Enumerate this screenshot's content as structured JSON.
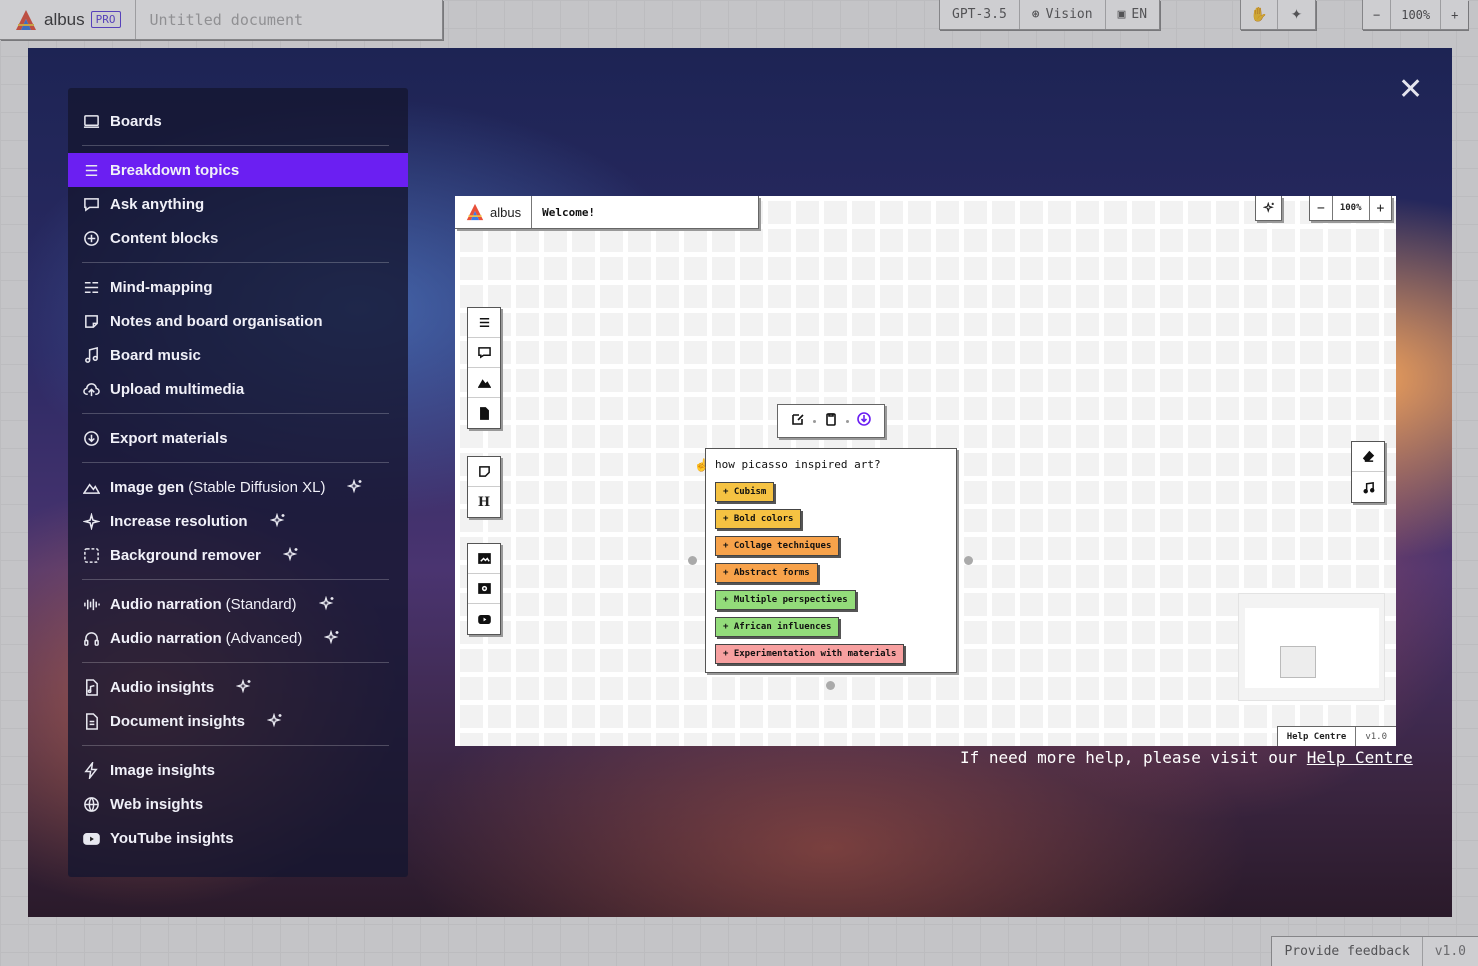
{
  "background_app": {
    "brand": "albus",
    "pro_badge": "PRO",
    "document_title": "Untitled document",
    "models": [
      "GPT-3.5",
      "Vision",
      "EN"
    ],
    "zoom": {
      "minus": "−",
      "value": "100%",
      "plus": "+"
    },
    "feedback": "Provide feedback",
    "version": "v1.0"
  },
  "modal": {
    "close": "✕"
  },
  "menu": {
    "boards": "Boards",
    "breakdown": "Breakdown topics",
    "ask": "Ask anything",
    "content_blocks": "Content blocks",
    "mind_mapping": "Mind-mapping",
    "notes": "Notes and board organisation",
    "music": "Board music",
    "upload": "Upload multimedia",
    "export": "Export materials",
    "image_gen": "Image gen",
    "image_gen_suffix": "(Stable Diffusion XL)",
    "increase_res": "Increase resolution",
    "bg_remover": "Background remover",
    "narration_std": "Audio narration",
    "narration_std_suffix": "(Standard)",
    "narration_adv": "Audio narration",
    "narration_adv_suffix": "(Advanced)",
    "audio_insights": "Audio insights",
    "doc_insights": "Document insights",
    "image_insights": "Image insights",
    "web_insights": "Web insights",
    "youtube_insights": "YouTube insights"
  },
  "preview": {
    "brand": "albus",
    "welcome": "Welcome!",
    "zoom": {
      "minus": "−",
      "value": "100%",
      "plus": "+"
    },
    "question": "how picasso inspired art?",
    "chips": [
      {
        "label": "+ Cubism",
        "color": "#f5c242"
      },
      {
        "label": "+ Bold colors",
        "color": "#f5c242"
      },
      {
        "label": "+ Collage techniques",
        "color": "#f7a24a"
      },
      {
        "label": "+ Abstract forms",
        "color": "#f7a24a"
      },
      {
        "label": "+ Multiple perspectives",
        "color": "#93dc7a"
      },
      {
        "label": "+ African influences",
        "color": "#93dc7a"
      },
      {
        "label": "+ Experimentation with materials",
        "color": "#f7a0a0"
      }
    ],
    "heading_tool": "H",
    "help_centre": "Help Centre",
    "version": "v1.0"
  },
  "help": {
    "text": "If need more help, please visit our",
    "link": "Help Centre"
  },
  "colors": {
    "accent": "#6b1ff2"
  }
}
